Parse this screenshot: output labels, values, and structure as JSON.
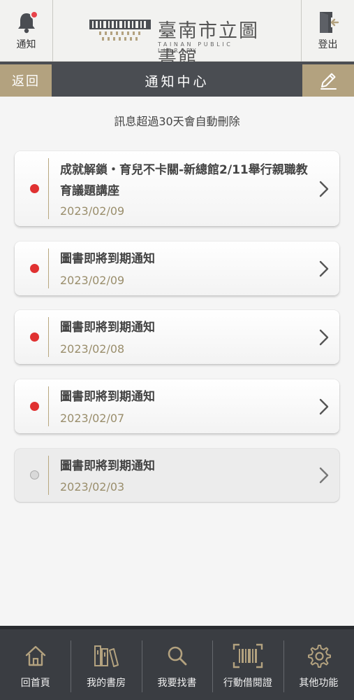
{
  "header": {
    "notify_label": "通知",
    "logout_label": "登出",
    "logo_name": "臺南市立圖書館",
    "logo_sub": "TAINAN PUBLIC LIBRARY",
    "has_unread": true
  },
  "titlebar": {
    "back_label": "返回",
    "title": "通知中心"
  },
  "notice": "訊息超過30天會自動刪除",
  "notifications": [
    {
      "title": "成就解鎖・育兒不卡關-新總館2/11舉行親職教育議題講座",
      "date": "2023/02/09",
      "unread": true
    },
    {
      "title": "圖書即將到期通知",
      "date": "2023/02/09",
      "unread": true
    },
    {
      "title": "圖書即將到期通知",
      "date": "2023/02/08",
      "unread": true
    },
    {
      "title": "圖書即將到期通知",
      "date": "2023/02/07",
      "unread": true
    },
    {
      "title": "圖書即將到期通知",
      "date": "2023/02/03",
      "unread": false
    }
  ],
  "bottom_nav": [
    {
      "label": "回首頁",
      "icon": "home-icon"
    },
    {
      "label": "我的書房",
      "icon": "books-icon"
    },
    {
      "label": "我要找書",
      "icon": "search-icon"
    },
    {
      "label": "行動借閱證",
      "icon": "barcode-icon"
    },
    {
      "label": "其他功能",
      "icon": "gear-icon"
    }
  ],
  "colors": {
    "accent_gold": "#b3a27f",
    "dark_bar": "#4a4d52",
    "unread_dot": "#e03131",
    "date_text": "#9a8e6c"
  }
}
